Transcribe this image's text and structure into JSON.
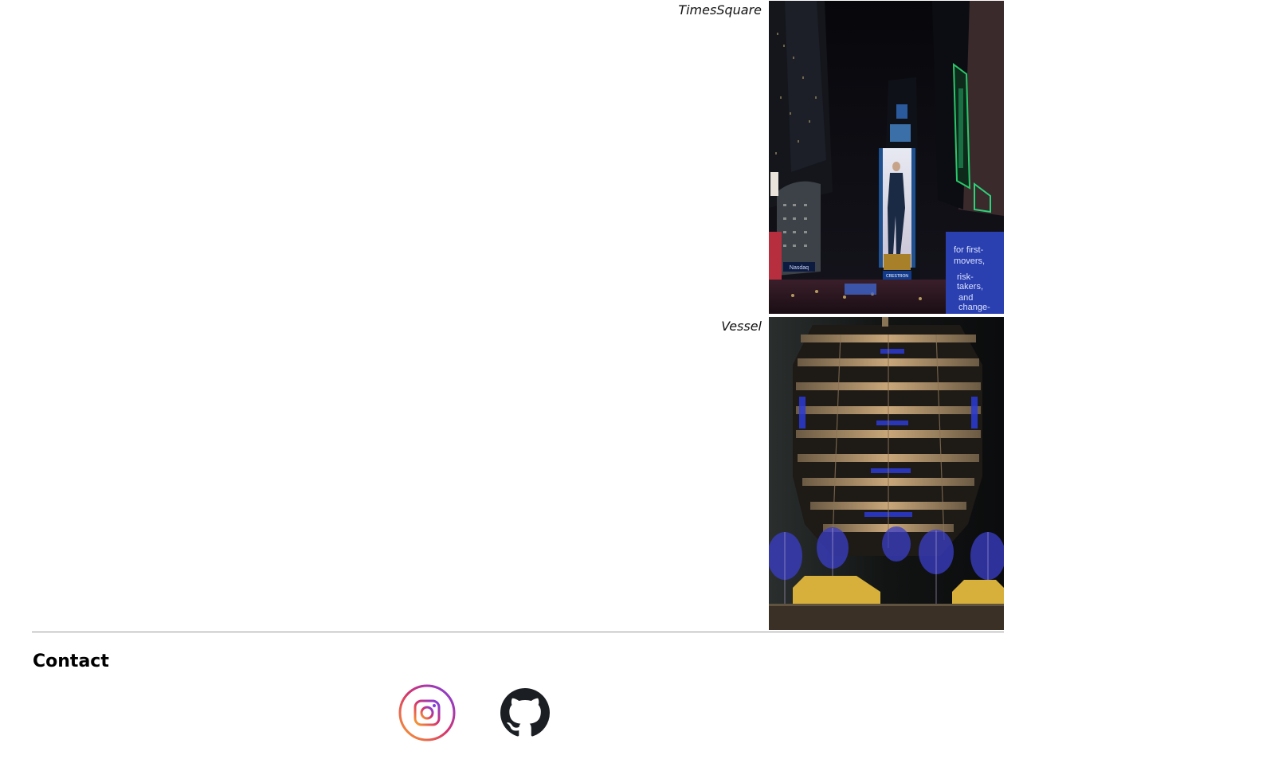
{
  "gallery": {
    "photos": [
      {
        "caption": "TimesSquare",
        "alt": "TimesSquare"
      },
      {
        "caption": "Vessel",
        "alt": "Vessel"
      }
    ],
    "billboard_text": {
      "crestron": "CRESTRON",
      "nasdaq": "Nasdaq",
      "ad_copy": "for first-movers, risk-takers, and change-makers"
    }
  },
  "contact": {
    "heading": "Contact",
    "links": [
      {
        "name": "instagram",
        "icon": "instagram-icon"
      },
      {
        "name": "github",
        "icon": "github-icon"
      }
    ]
  },
  "colors": {
    "background": "#ffffff",
    "divider": "#9a9a9a",
    "instagram_gradient_start": "#f9a12e",
    "instagram_gradient_mid": "#d6336c",
    "instagram_gradient_end": "#7b3fe4",
    "github": "#1b1f23"
  }
}
